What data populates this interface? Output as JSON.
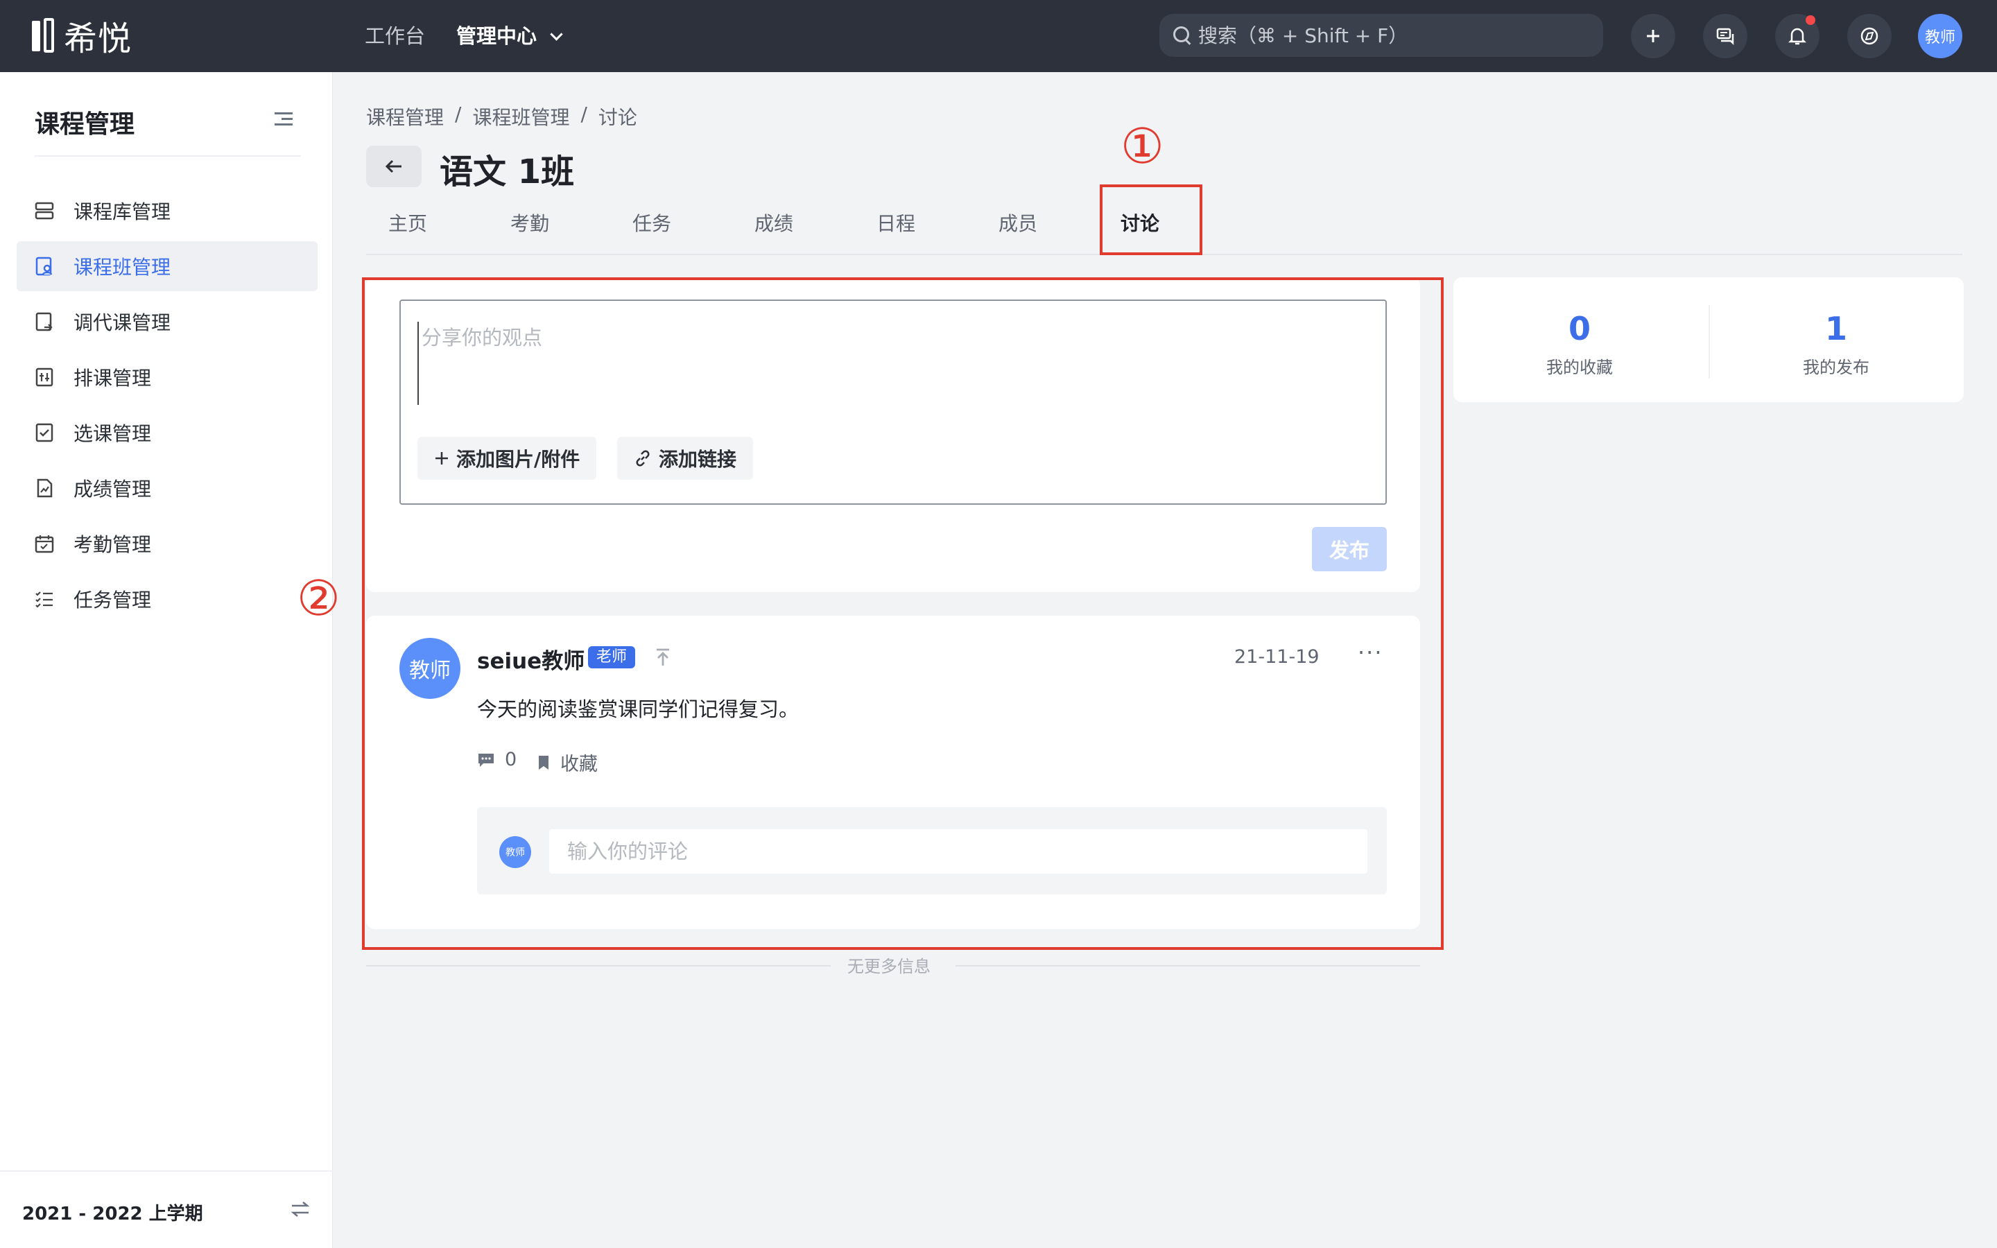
{
  "app": {
    "name": "希悦"
  },
  "topnav": {
    "items": [
      {
        "label": "工作台",
        "active": false
      },
      {
        "label": "管理中心",
        "active": true
      }
    ],
    "search_placeholder": "搜索（⌘ + Shift + F）",
    "avatar_label": "教师"
  },
  "sidebar": {
    "title": "课程管理",
    "items": [
      {
        "label": "课程库管理",
        "icon": "database-icon",
        "active": false
      },
      {
        "label": "课程班管理",
        "icon": "class-icon",
        "active": true
      },
      {
        "label": "调代课管理",
        "icon": "swap-lesson-icon",
        "active": false
      },
      {
        "label": "排课管理",
        "icon": "schedule-icon",
        "active": false
      },
      {
        "label": "选课管理",
        "icon": "check-square-icon",
        "active": false
      },
      {
        "label": "成绩管理",
        "icon": "grade-chart-icon",
        "active": false
      },
      {
        "label": "考勤管理",
        "icon": "calendar-check-icon",
        "active": false
      },
      {
        "label": "任务管理",
        "icon": "task-list-icon",
        "active": false
      }
    ],
    "term": "2021 - 2022 上学期"
  },
  "breadcrumb": [
    "课程管理",
    "/",
    "课程班管理",
    "/",
    "讨论"
  ],
  "page": {
    "title": "语文 1班"
  },
  "tabs": [
    {
      "label": "主页",
      "active": false
    },
    {
      "label": "考勤",
      "active": false
    },
    {
      "label": "任务",
      "active": false
    },
    {
      "label": "成绩",
      "active": false
    },
    {
      "label": "日程",
      "active": false
    },
    {
      "label": "成员",
      "active": false
    },
    {
      "label": "讨论",
      "active": true
    }
  ],
  "annotations": {
    "one": "①",
    "two": "②"
  },
  "composer": {
    "placeholder": "分享你的观点",
    "add_attachment": "添加图片/附件",
    "add_link": "添加链接",
    "publish": "发布"
  },
  "post": {
    "avatar": "教师",
    "author": "seiue教师",
    "badge": "老师",
    "date": "21-11-19",
    "more": "···",
    "body": "今天的阅读鉴赏课同学们记得复习。",
    "comment_count": "0",
    "favorite_label": "收藏",
    "comment_avatar": "教师",
    "comment_placeholder": "输入你的评论"
  },
  "end_text": "无更多信息",
  "stats": [
    {
      "value": "0",
      "label": "我的收藏"
    },
    {
      "value": "1",
      "label": "我的发布"
    }
  ],
  "colors": {
    "accent": "#3b6ee8",
    "topbar": "#2c313c",
    "annotation": "#e03b2e"
  }
}
